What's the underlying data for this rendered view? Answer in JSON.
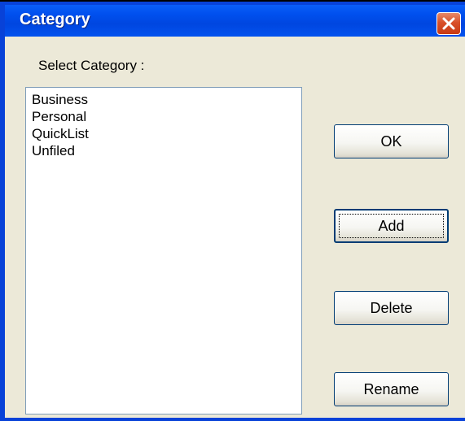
{
  "dialog": {
    "title": "Category",
    "select_label": "Select Category :",
    "categories": [
      "Business",
      "Personal",
      "QuickList",
      "Unfiled"
    ],
    "buttons": {
      "ok": "OK",
      "add": "Add",
      "delete": "Delete",
      "rename": "Rename"
    },
    "focused_button": "Add",
    "icons": {
      "close": "close-icon"
    },
    "colors": {
      "titlebar": "#0050ee",
      "client": "#ece9d8",
      "close_button": "#d8502a"
    }
  }
}
